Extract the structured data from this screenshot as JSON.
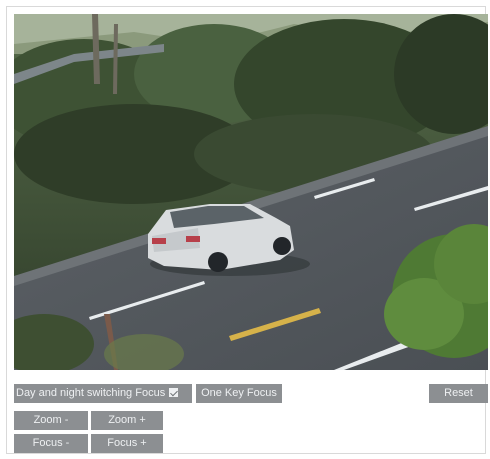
{
  "video": {
    "scene_description_icon": "camera-feed"
  },
  "controls": {
    "day_night_switching_focus": {
      "label": "Day and night switching Focus",
      "checked": true
    },
    "one_key_focus": "One Key Focus",
    "reset": "Reset",
    "zoom_minus": "Zoom -",
    "zoom_plus": "Zoom +",
    "focus_minus": "Focus -",
    "focus_plus": "Focus +"
  },
  "colors": {
    "button_bg": "#8c8f92",
    "button_text": "#eef0f2"
  }
}
